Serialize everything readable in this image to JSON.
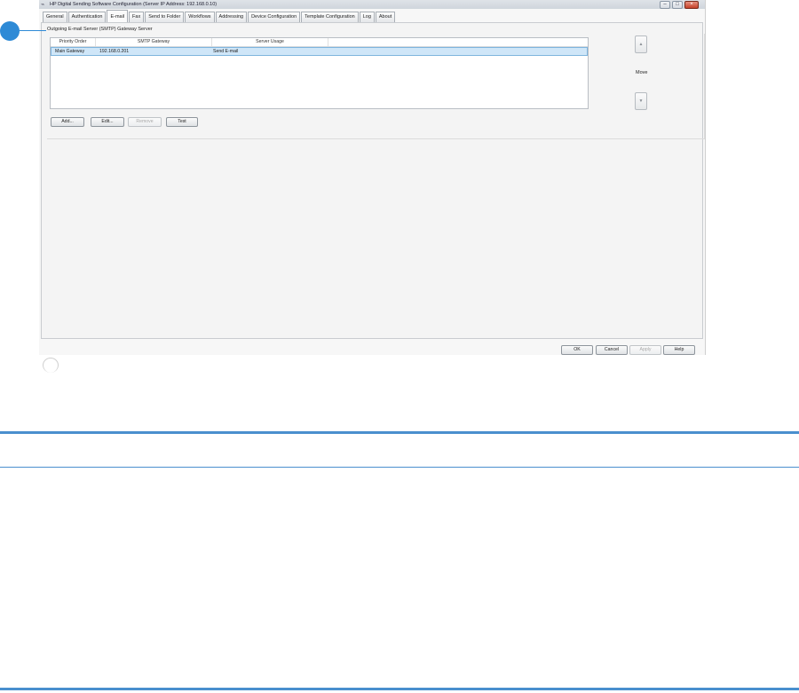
{
  "window": {
    "title": "HP Digital Sending Software Configuration (Server IP Address: 192.168.0.10)",
    "controls": {
      "minimize": "–",
      "maximize": "□",
      "close": "×"
    }
  },
  "tabs": [
    {
      "label": "General",
      "active": false
    },
    {
      "label": "Authentication",
      "active": false
    },
    {
      "label": "E-mail",
      "active": true
    },
    {
      "label": "Fax",
      "active": false
    },
    {
      "label": "Send to Folder",
      "active": false
    },
    {
      "label": "Workflows",
      "active": false
    },
    {
      "label": "Addressing",
      "active": false
    },
    {
      "label": "Device Configuration",
      "active": false
    },
    {
      "label": "Template Configuration",
      "active": false
    },
    {
      "label": "Log",
      "active": false
    },
    {
      "label": "About",
      "active": false
    }
  ],
  "section": {
    "title": "Outgoing E-mail Server (SMTP) Gateway Server"
  },
  "grid": {
    "columns": [
      "Priority Order",
      "SMTP Gateway",
      "Server Usage"
    ],
    "rows": [
      {
        "priority": "Main Gateway",
        "gateway": "192.168.0.201",
        "usage": "Send E-mail",
        "selected": true
      }
    ]
  },
  "actions": {
    "add": "Add...",
    "edit": "Edit...",
    "remove": "Remove",
    "test": "Test"
  },
  "move": {
    "label": "Move",
    "up_icon": "up-arrow-icon",
    "down_icon": "down-arrow-icon"
  },
  "footer": {
    "ok": "OK",
    "cancel": "Cancel",
    "apply": "Apply",
    "help": "Help"
  },
  "colors": {
    "callout": "#2e8ad6",
    "selection": "#cfe6f8",
    "rule": "#4a8fce"
  }
}
